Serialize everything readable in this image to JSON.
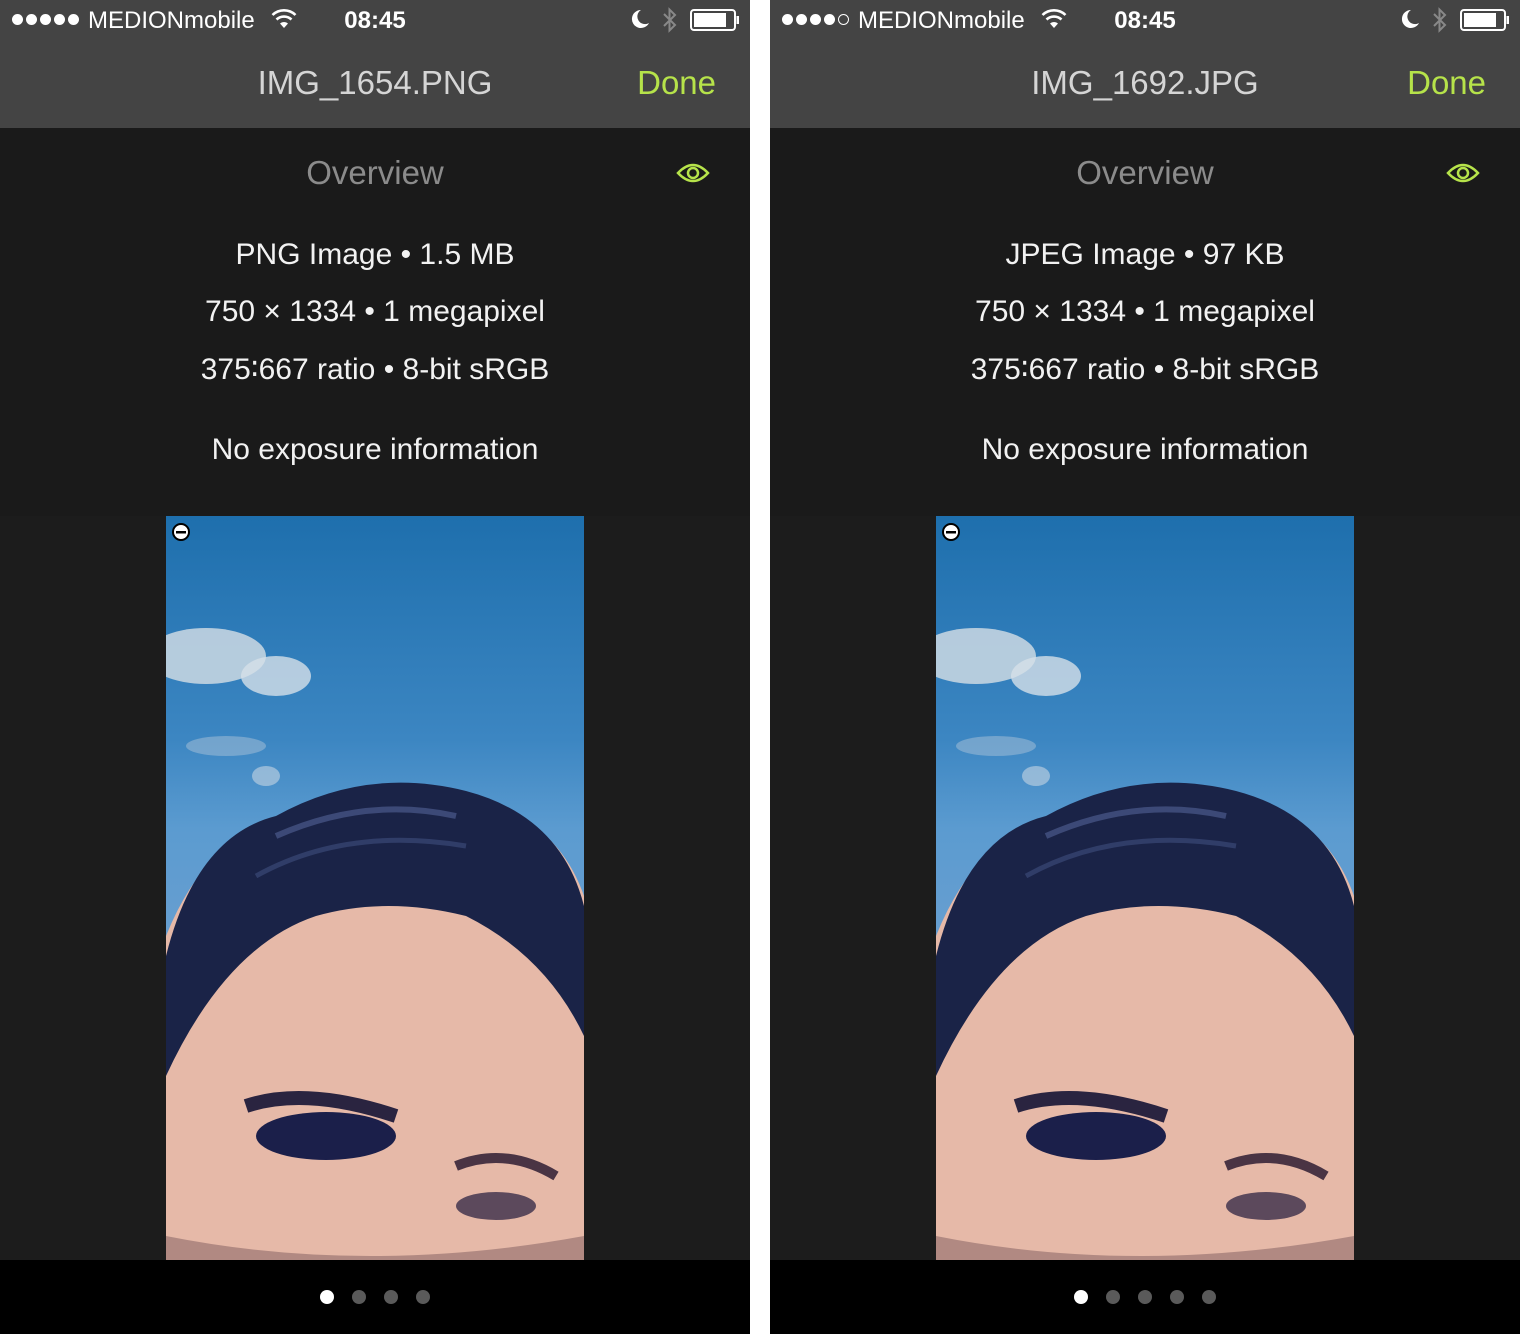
{
  "colors": {
    "accent": "#b6e34a",
    "bar_background": "#444444",
    "panel_background": "#1a1a1a",
    "footer_background": "#000000"
  },
  "screens": [
    {
      "status_bar": {
        "signal_bars_filled": 5,
        "signal_bars_total": 5,
        "carrier": "MEDIONmobile",
        "time": "08:45",
        "icons": [
          "wifi-icon",
          "moon-icon",
          "bluetooth-icon",
          "battery-icon"
        ]
      },
      "nav": {
        "title": "IMG_1654.PNG",
        "done_label": "Done"
      },
      "overview": {
        "title": "Overview",
        "icon": "eye-icon",
        "line1": "PNG Image • 1.5 MB",
        "line2": "750 × 1334 • 1 megapixel",
        "line3": "375∶667 ratio • 8-bit sRGB",
        "line4": "No exposure information"
      },
      "preview": {
        "description_icon": "minus-circle-icon"
      },
      "pager": {
        "page_count": 4,
        "current_page": 1
      }
    },
    {
      "status_bar": {
        "signal_bars_filled": 4,
        "signal_bars_total": 5,
        "carrier": "MEDIONmobile",
        "time": "08:45",
        "icons": [
          "wifi-icon",
          "moon-icon",
          "bluetooth-icon",
          "battery-icon"
        ]
      },
      "nav": {
        "title": "IMG_1692.JPG",
        "done_label": "Done"
      },
      "overview": {
        "title": "Overview",
        "icon": "eye-icon",
        "line1": "JPEG Image • 97 KB",
        "line2": "750 × 1334 • 1 megapixel",
        "line3": "375∶667 ratio • 8-bit sRGB",
        "line4": "No exposure information"
      },
      "preview": {
        "description_icon": "minus-circle-icon"
      },
      "pager": {
        "page_count": 5,
        "current_page": 1
      }
    }
  ]
}
